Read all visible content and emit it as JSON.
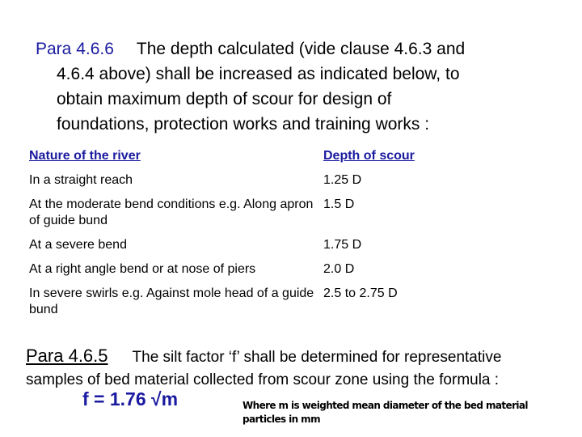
{
  "intro": {
    "para_number": "Para 4.6.6",
    "lines": [
      "The depth calculated (vide clause 4.6.3 and",
      "4.6.4 above) shall be increased as indicated below, to",
      "obtain maximum depth of scour for design of",
      "foundations, protection works and training works :"
    ]
  },
  "table": {
    "headers": [
      "Nature of the river",
      "Depth of scour"
    ],
    "rows": [
      {
        "nature": "In a straight reach",
        "depth": "1.25 D"
      },
      {
        "nature": "At the moderate bend conditions e.g. Along apron of guide bund",
        "depth": "1.5 D"
      },
      {
        "nature": "At a severe bend",
        "depth": "1.75 D"
      },
      {
        "nature": "At a right angle bend or at nose of piers",
        "depth": "2.0 D"
      },
      {
        "nature": "In severe swirls e.g. Against mole head of a guide bund",
        "depth": "2.5 to 2.75 D"
      }
    ]
  },
  "para2": {
    "para_number": "Para 4.6.5",
    "line1": "The silt factor ‘f’ shall be determined for representative",
    "line2": "samples of bed material collected from scour zone using the formula :"
  },
  "formula": "f = 1.76 √m",
  "note": "Where m is weighted mean diameter of the bed material particles in mm",
  "colors": {
    "accent_blue": "#1a1aa0",
    "text": "#000000",
    "background": "#ffffff"
  }
}
